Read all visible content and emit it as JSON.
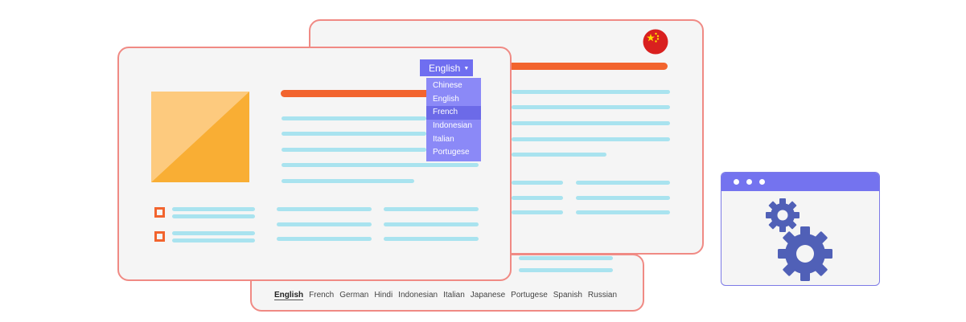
{
  "languages_bar": [
    "English",
    "French",
    "German",
    "Hindi",
    "Indonesian",
    "Italian",
    "Japanese",
    "Portugese",
    "Spanish",
    "Russian"
  ],
  "dropdown": {
    "selected_label": "English",
    "caret_icon": "caret-down-icon",
    "options": [
      "Chinese",
      "English",
      "French",
      "Indonesian",
      "Italian",
      "Portugese"
    ],
    "highlighted": "French"
  },
  "flag_icon": "china-flag-icon",
  "colors": {
    "accent_purple": "#6f6ef0",
    "orange": "#f2642e",
    "card_border": "#f08a84",
    "text_line": "#a9e3ef",
    "image_light": "#fdca7e",
    "image_dark": "#f9ae34",
    "gear": "#5060b7"
  }
}
